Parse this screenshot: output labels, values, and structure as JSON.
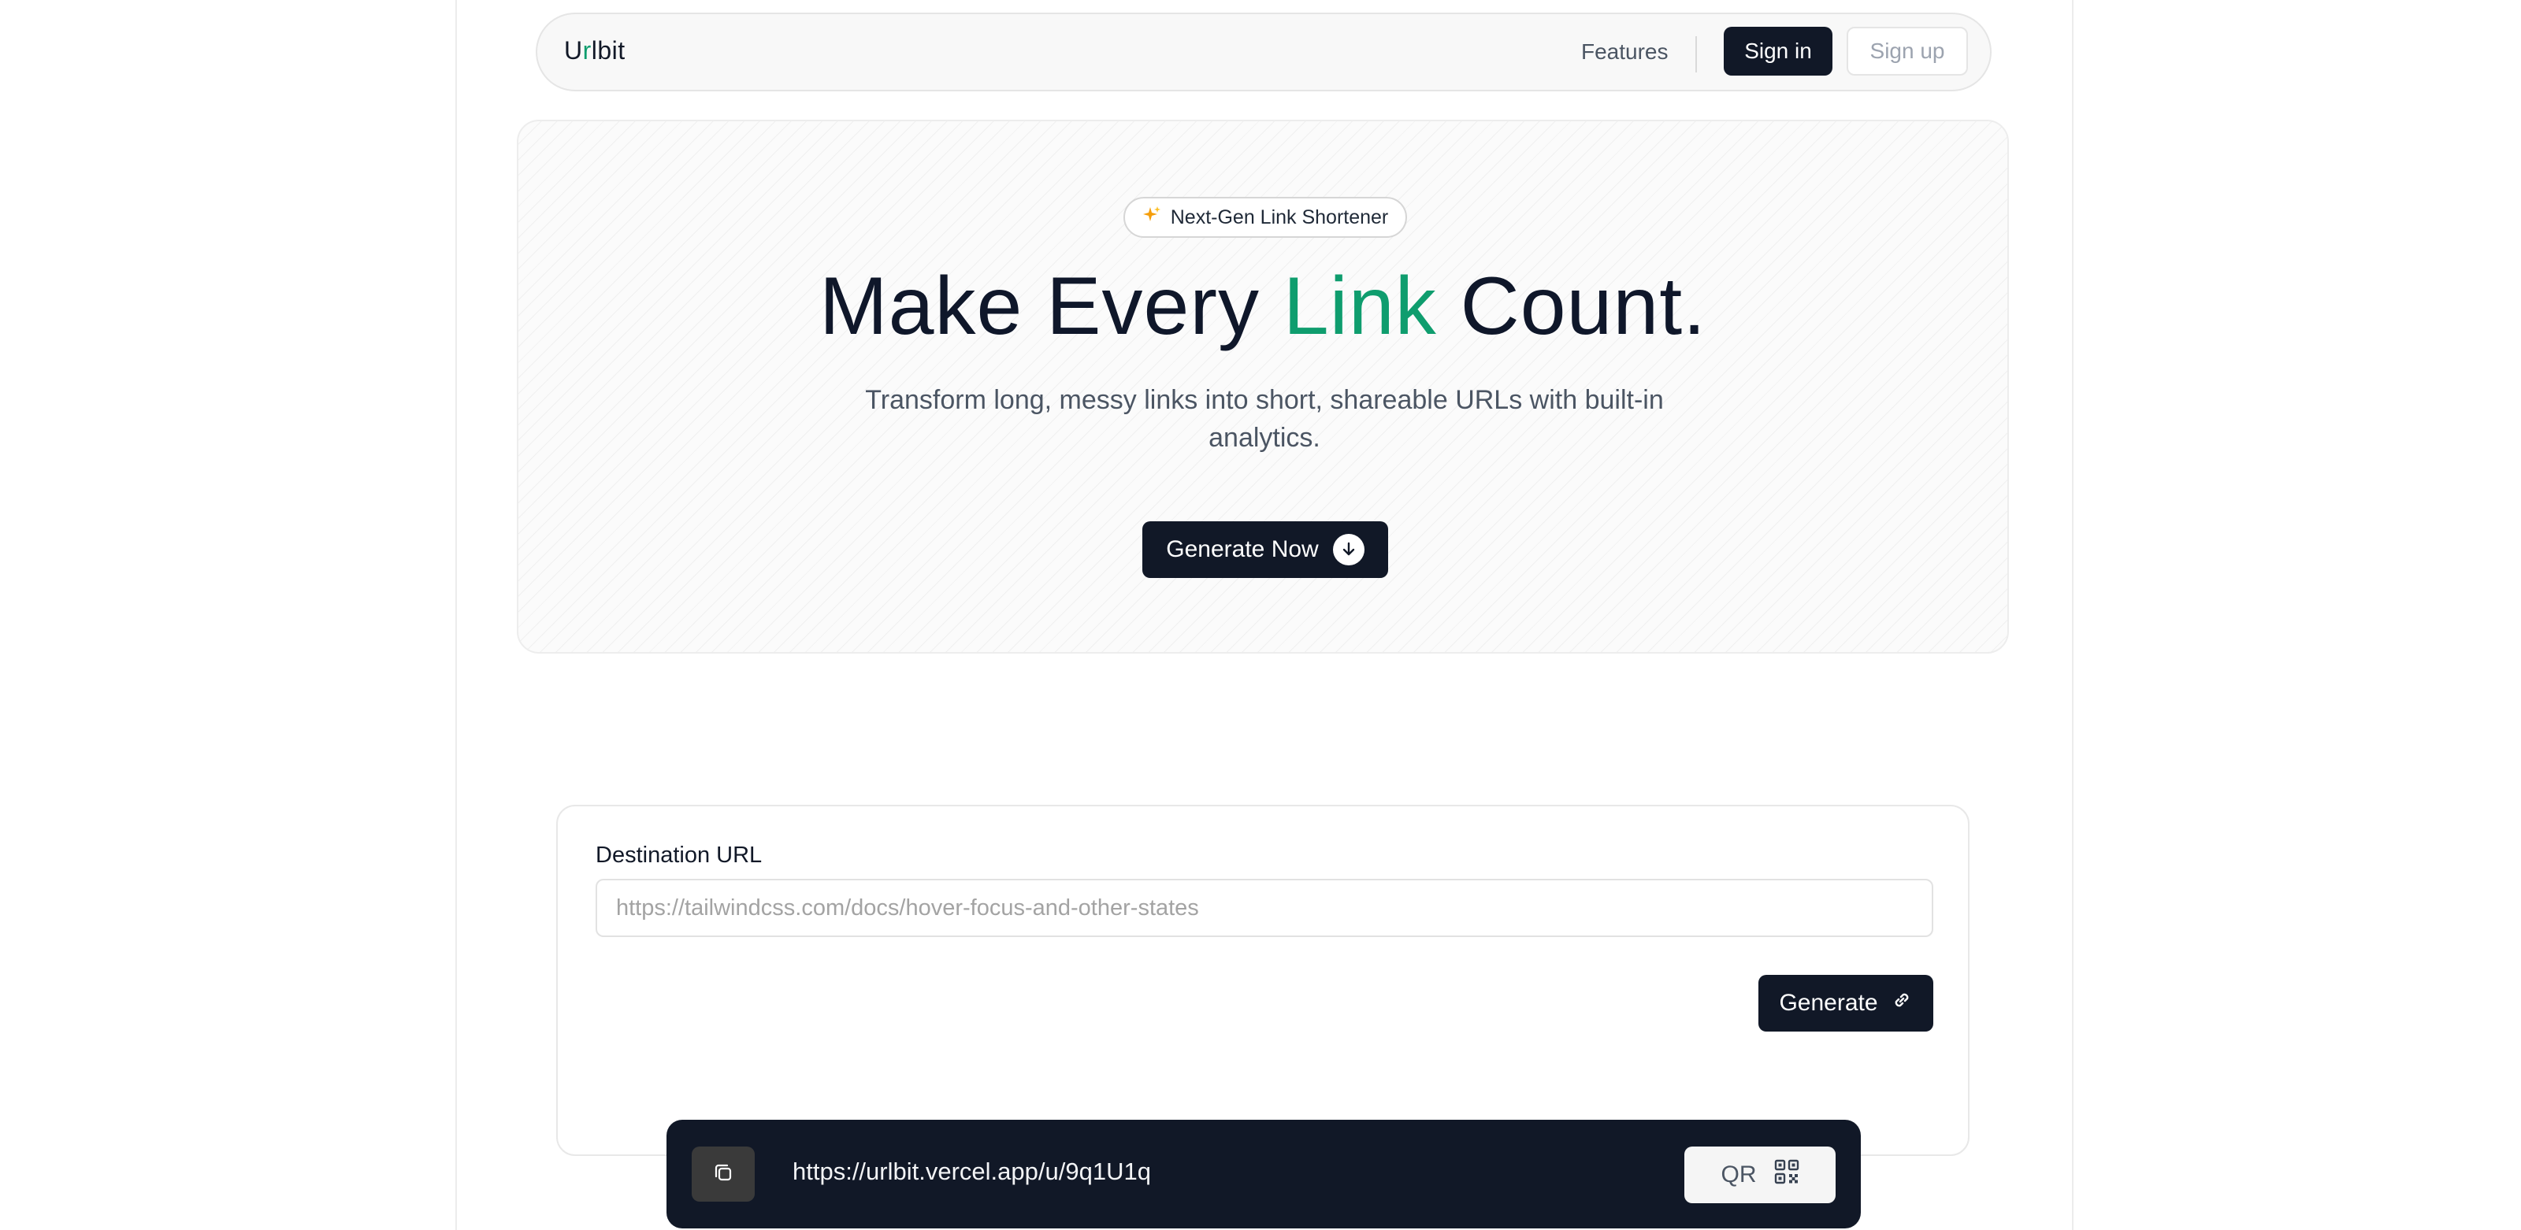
{
  "nav": {
    "logo_prefix": "U",
    "logo_accent": "r",
    "logo_suffix": "lbit",
    "features_label": "Features",
    "signin_label": "Sign in",
    "signup_label": "Sign up"
  },
  "hero": {
    "badge_icon": "sparkles-icon",
    "badge_label": "Next-Gen Link Shortener",
    "headline_start": "Make Every ",
    "headline_accent": "Link",
    "headline_end": " Count.",
    "subtitle": "Transform long, messy links into short, shareable URLs with built-in analytics.",
    "cta_label": "Generate Now",
    "accent_color": "#0f9d6e"
  },
  "form": {
    "label": "Destination URL",
    "input_value": "",
    "input_placeholder": "https://tailwindcss.com/docs/hover-focus-and-other-states",
    "generate_label": "Generate"
  },
  "result": {
    "short_url": "https://urlbit.vercel.app/u/9q1U1q",
    "qr_label": "QR"
  }
}
